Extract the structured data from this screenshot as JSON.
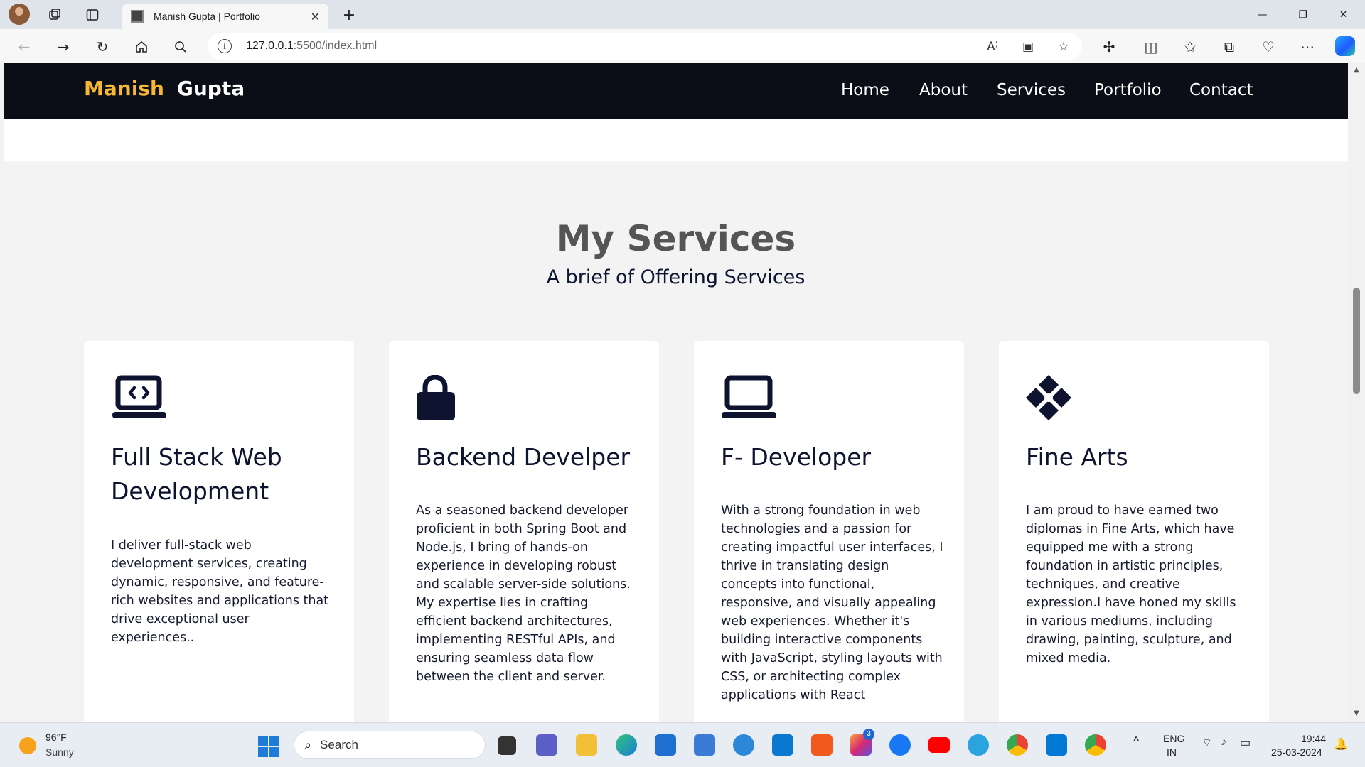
{
  "browser": {
    "tab_title": "Manish Gupta | Portfolio",
    "tab_close": "✕",
    "new_tab": "+",
    "url_host": "127.0.0.1",
    "url_rest": ":5500/index.html",
    "window_controls": {
      "minimize": "—",
      "restore": "❐",
      "close": "✕"
    }
  },
  "site": {
    "brand_first": "Manish",
    "brand_last": "Gupta",
    "nav": [
      "Home",
      "About",
      "Services",
      "Portfolio",
      "Contact"
    ]
  },
  "services": {
    "title": "My Services",
    "subtitle": "A brief of Offering Services",
    "cards": [
      {
        "icon": "laptop-code-icon",
        "title": "Full Stack Web Development",
        "text": "I deliver full-stack web development services, creating dynamic, responsive, and feature-rich websites and applications that drive exceptional user experiences.."
      },
      {
        "icon": "lock-icon",
        "title": "Backend Develper",
        "text": "As a seasoned backend developer proficient in both Spring Boot and Node.js, I bring of hands-on experience in developing robust and scalable server-side solutions. My expertise lies in crafting efficient backend architectures, implementing RESTful APIs, and ensuring seamless data flow between the client and server."
      },
      {
        "icon": "laptop-icon",
        "title": "F- Developer",
        "text": "With a strong foundation in web technologies and a passion for creating impactful user interfaces, I thrive in translating design concepts into functional, responsive, and visually appealing web experiences. Whether it's building interactive components with JavaScript, styling layouts with CSS, or architecting complex applications with React"
      },
      {
        "icon": "diamond-pattern-icon",
        "title": "Fine Arts",
        "text": "I am proud to have earned two diplomas in Fine Arts, which have equipped me with a strong foundation in artistic principles, techniques, and creative expression.I have honed my skills in various mediums, including drawing, painting, sculpture, and mixed media."
      }
    ]
  },
  "taskbar": {
    "weather_temp": "96°F",
    "weather_desc": "Sunny",
    "search_label": "Search",
    "instagram_badge": "3",
    "lang_line1": "ENG",
    "lang_line2": "IN",
    "time": "19:44",
    "date": "25-03-2024"
  },
  "colors": {
    "nav_bg": "#0b0e17",
    "brand_accent": "#f4b934",
    "page_bg": "#f3f3f3",
    "card_bg": "#ffffff",
    "heading_gray": "#555555"
  }
}
